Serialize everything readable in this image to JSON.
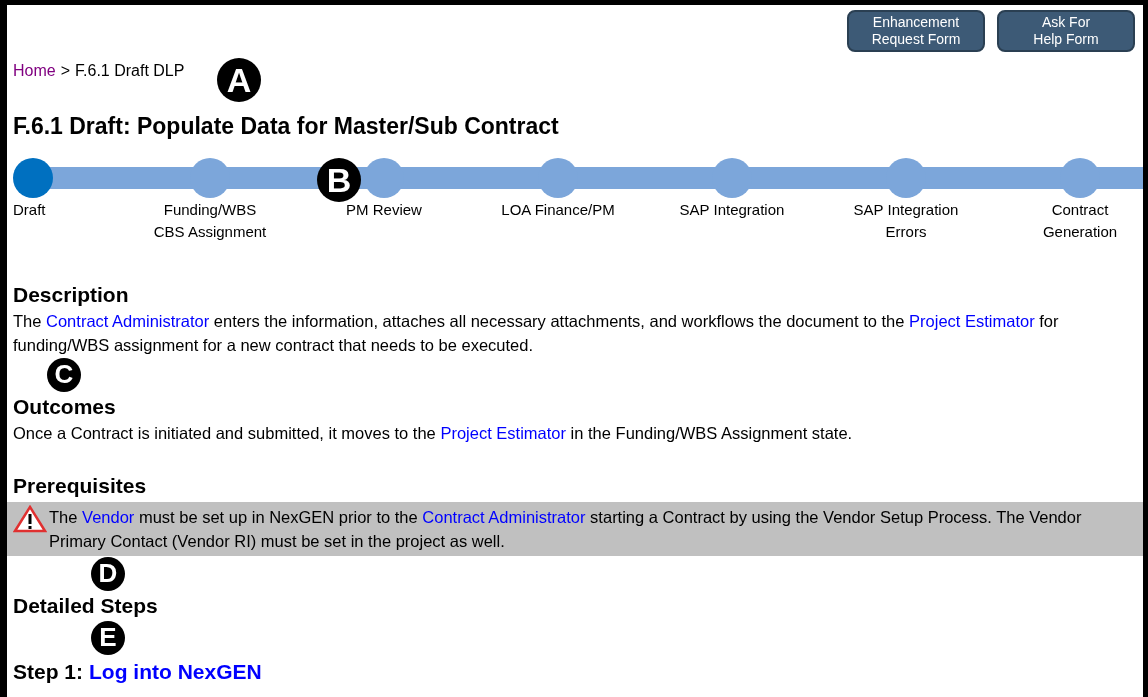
{
  "header_buttons": [
    {
      "lines": [
        "Enhancement",
        "Request Form"
      ]
    },
    {
      "lines": [
        "Ask For",
        "Help Form"
      ]
    }
  ],
  "breadcrumb": {
    "items": [
      {
        "text": "Home",
        "link": true
      },
      {
        "text": "F.6.1 Draft DLP",
        "link": false
      }
    ],
    "separator": ">"
  },
  "title": "F.6.1 Draft: Populate Data for Master/Sub Contract",
  "process_steps": [
    {
      "lines": [
        "Draft"
      ],
      "selected": true
    },
    {
      "lines": [
        "Funding/WBS",
        "CBS Assignment"
      ],
      "selected": false
    },
    {
      "lines": [
        "PM Review"
      ],
      "selected": false
    },
    {
      "lines": [
        "LOA Finance/PM"
      ],
      "selected": false
    },
    {
      "lines": [
        "SAP Integration"
      ],
      "selected": false
    },
    {
      "lines": [
        "SAP Integration",
        "Errors"
      ],
      "selected": false
    },
    {
      "lines": [
        "Contract",
        "Generation"
      ],
      "selected": false
    }
  ],
  "sections": [
    {
      "kind": "text",
      "heading": "Description",
      "segments": [
        {
          "text": "The ",
          "link": false
        },
        {
          "text": "Contract Administrator",
          "link": true
        },
        {
          "text": " enters the information, attaches all necessary attachments, and workflows the document to the ",
          "link": false
        },
        {
          "text": "Project Estimator",
          "link": true
        },
        {
          "text": " for funding/WBS assignment for a new contract that needs to be executed.",
          "link": false
        }
      ]
    },
    {
      "kind": "text",
      "heading": "Outcomes",
      "segments": [
        {
          "text": "Once a Contract is initiated and submitted, it moves to the ",
          "link": false
        },
        {
          "text": "Project Estimator",
          "link": true
        },
        {
          "text": " in the Funding/WBS Assignment state.",
          "link": false
        }
      ]
    },
    {
      "kind": "warning",
      "heading": "Prerequisites",
      "segments": [
        {
          "text": "The ",
          "link": false
        },
        {
          "text": "Vendor",
          "link": true
        },
        {
          "text": " must be set up in NexGEN prior to the ",
          "link": false
        },
        {
          "text": "Contract Administrator",
          "link": true
        },
        {
          "text": " starting a Contract by using the Vendor Setup Process. The Vendor Primary Contact (Vendor RI) must be set in the project as well.",
          "link": false
        }
      ]
    },
    {
      "kind": "steps",
      "heading": "Detailed Steps",
      "steps": [
        {
          "label": "Step 1:",
          "link": "Log into NexGEN"
        }
      ]
    }
  ],
  "markers": [
    {
      "letter": "A"
    },
    {
      "letter": "B"
    },
    {
      "letter": "C"
    },
    {
      "letter": "D"
    },
    {
      "letter": "E"
    }
  ]
}
